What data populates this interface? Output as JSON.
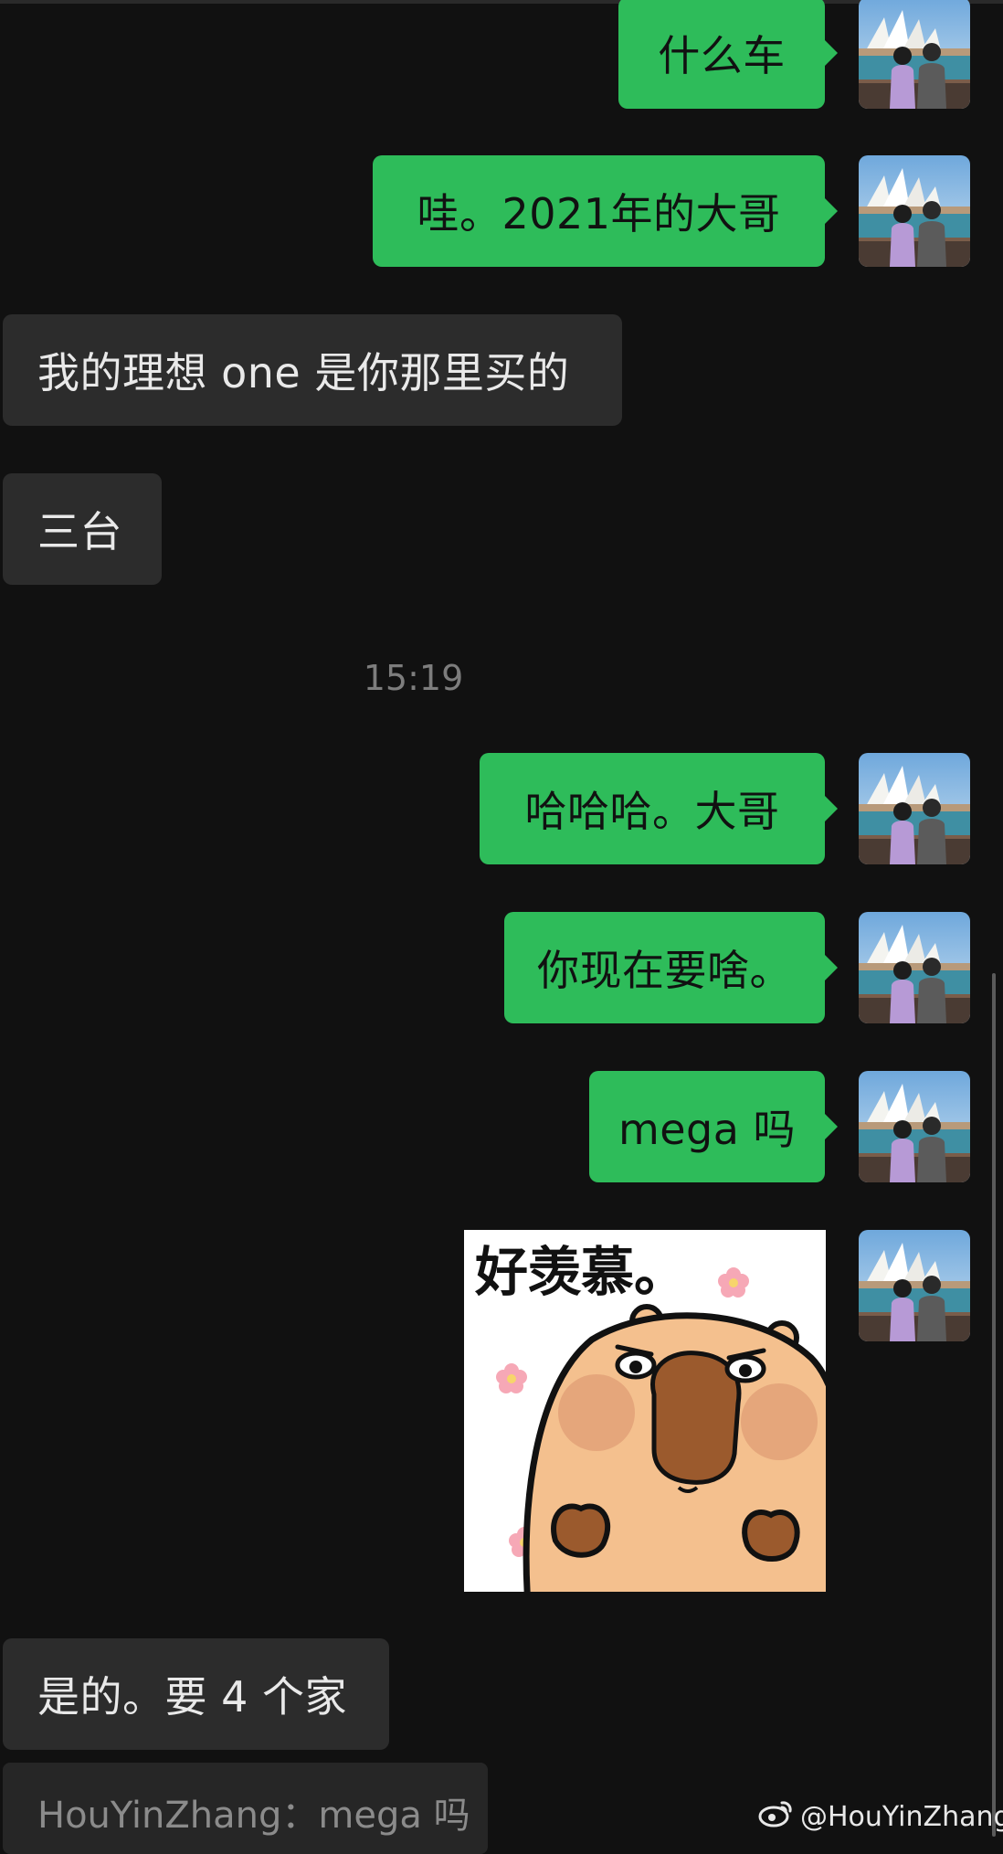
{
  "messages": [
    {
      "id": "m1",
      "text": "什么车"
    },
    {
      "id": "m2",
      "text": "哇。2021年的大哥"
    },
    {
      "id": "m3",
      "text": "我的理想 one 是你那里买的"
    },
    {
      "id": "m4",
      "text": "三台"
    },
    {
      "id": "m5",
      "text": "哈哈哈。大哥"
    },
    {
      "id": "m6",
      "text": "你现在要啥。"
    },
    {
      "id": "m7",
      "text": "mega 吗"
    },
    {
      "id": "m8",
      "text": "是的。要 4 个家"
    }
  ],
  "timestamp": "15:19",
  "sticker": {
    "caption": "好羡慕。"
  },
  "quoted_reply": {
    "text": "HouYinZhang：mega 吗"
  },
  "watermark": {
    "text": "@HouYinZhang",
    "icon": "weibo-icon"
  },
  "colors": {
    "background": "#111111",
    "outgoing_bubble": "#2ebc5a",
    "incoming_bubble": "#2c2c2c",
    "incoming_text": "#e9e9e9",
    "timestamp_text": "#7d7d7d"
  }
}
